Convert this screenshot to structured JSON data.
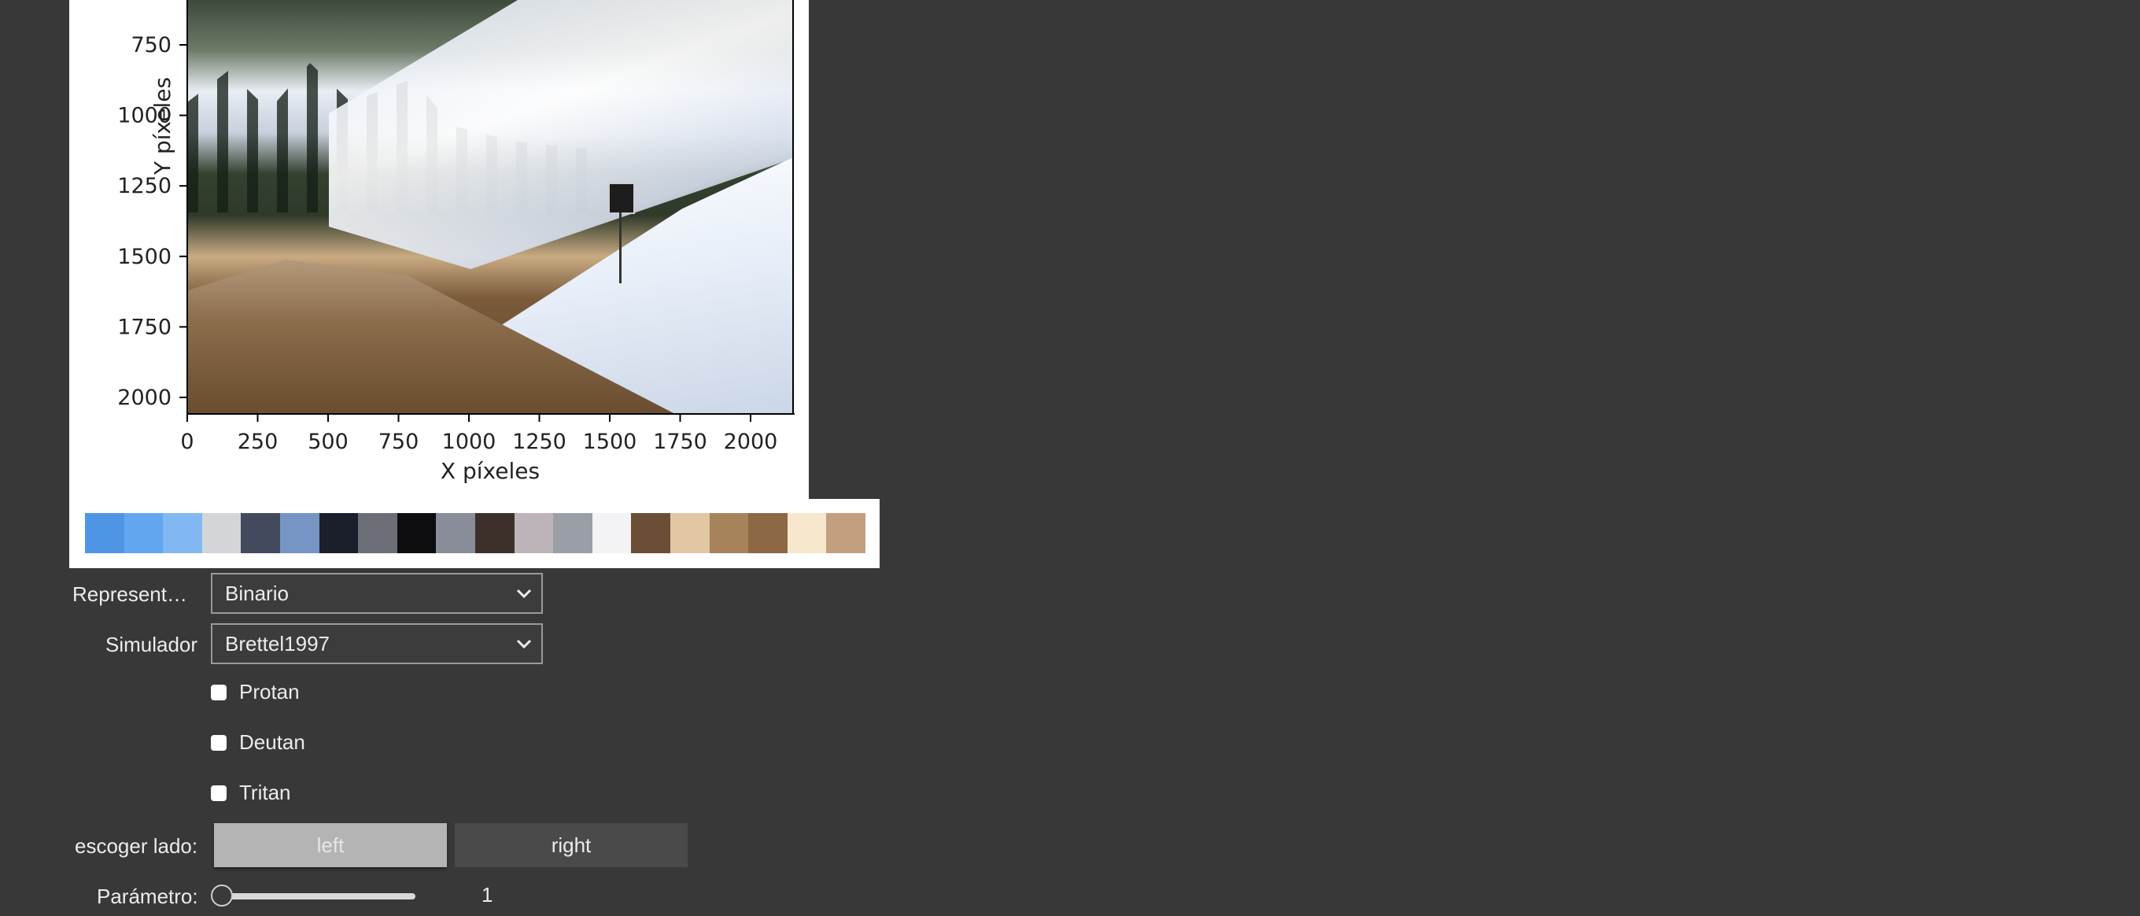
{
  "plot": {
    "xlabel": "X píxeles",
    "ylabel": "Y píxeles",
    "xticks": [
      "0",
      "250",
      "500",
      "750",
      "1000",
      "1250",
      "1500",
      "1750",
      "2000"
    ],
    "yticks": [
      "750",
      "1000",
      "1250",
      "1500",
      "1750",
      "2000"
    ]
  },
  "palette": {
    "colors": [
      "#4f95e6",
      "#62a6f0",
      "#82b8f2",
      "#d4d5d9",
      "#434a5d",
      "#7694c4",
      "#1b1f2c",
      "#6c6e77",
      "#0e0d10",
      "#898d99",
      "#3d302a",
      "#bdb4ba",
      "#9a9ea6",
      "#f3f2f5",
      "#6a4f36",
      "#e1c7a4",
      "#a7835c",
      "#8d6844",
      "#f7e7cd",
      "#c2a07f"
    ]
  },
  "controls": {
    "representation": {
      "label": "Represent…",
      "value": "Binario"
    },
    "simulator": {
      "label": "Simulador",
      "value": "Brettel1997"
    },
    "checkboxes": [
      {
        "label": "Protan",
        "checked": false
      },
      {
        "label": "Deutan",
        "checked": false
      },
      {
        "label": "Tritan",
        "checked": false
      }
    ],
    "side": {
      "label": "escoger lado:",
      "left": "left",
      "right": "right",
      "selected": "left"
    },
    "parameter": {
      "label": "Parámetro:",
      "value": "1",
      "level": 0
    }
  }
}
